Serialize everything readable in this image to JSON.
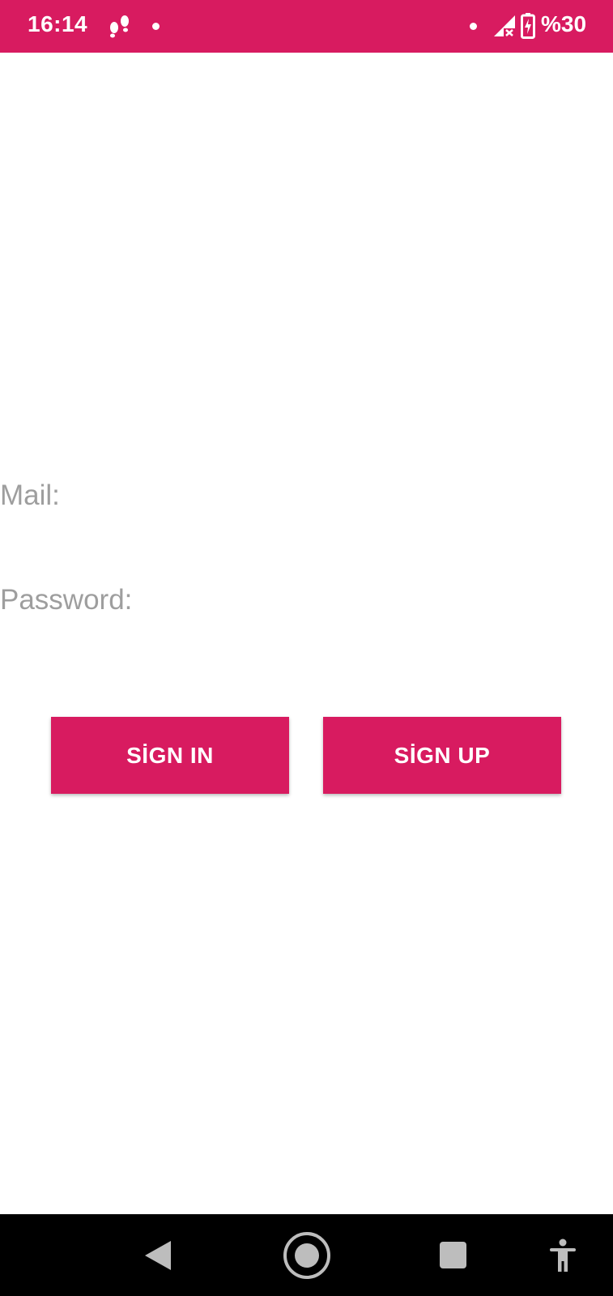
{
  "status_bar": {
    "time": "16:14",
    "battery": "%30",
    "icons": [
      "notification-icon",
      "dot-icon",
      "signal-icon",
      "battery-charging-icon"
    ],
    "background_color": "#d81b60"
  },
  "form": {
    "mail_label": "Mail:",
    "mail_value": "",
    "password_label": "Password:",
    "password_value": ""
  },
  "buttons": {
    "sign_in": "SİGN IN",
    "sign_up": "SİGN UP",
    "color": "#d81b60"
  },
  "nav_bar": {
    "icons": [
      "back-icon",
      "home-icon",
      "recents-icon",
      "accessibility-icon"
    ]
  }
}
